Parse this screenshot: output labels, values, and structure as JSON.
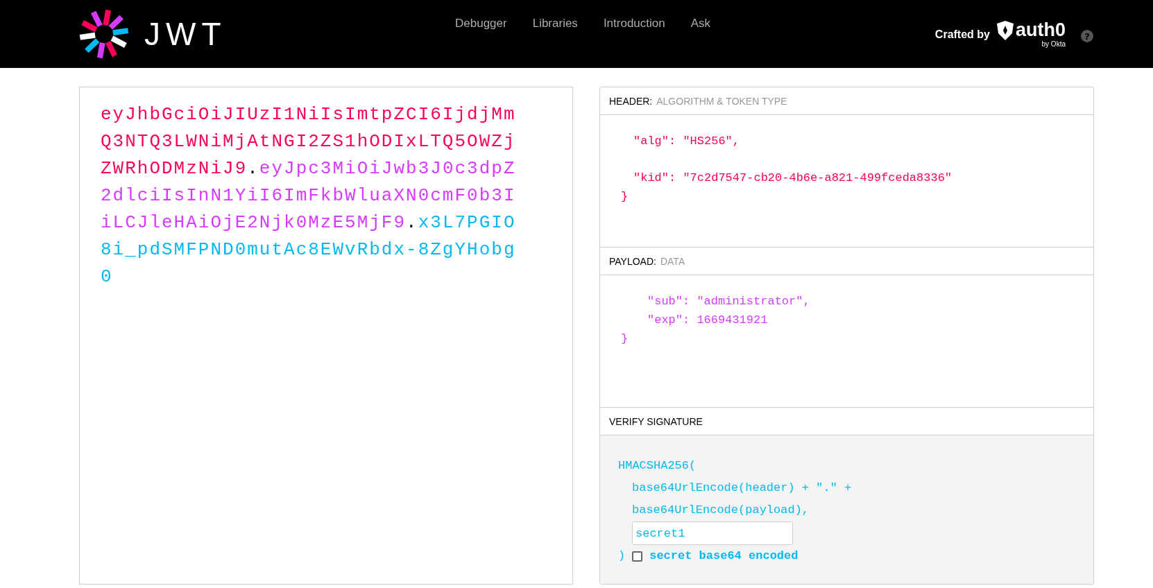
{
  "nav": {
    "logo_text": "JWT",
    "links": [
      "Debugger",
      "Libraries",
      "Introduction",
      "Ask"
    ],
    "crafted_by": "Crafted by",
    "brand": "auth0",
    "brand_sub": "by Okta",
    "help": "?"
  },
  "encoded": {
    "parts": [
      {
        "text": "eyJhbGciOiJIUzI1NiIsImtpZCI6IjdjMmQ3NTQ3LWNiMjAtNGI2ZS1hODIxLTQ5OWZjZWRhODMzNiJ9",
        "color": "#fb015b"
      },
      {
        "text": "eyJpc3MiOiJwb3J0c3dpZ2dlciIsInN1YiI6ImFkbWluaXN0cmF0b3IiLCJleHAiOjE2Njk0MzE5MjF9",
        "color": "#d63aff"
      },
      {
        "text": "x3L7PGIO8i_pdSMFPND0mutAc8EWvRbdx-8ZgYHobg0",
        "color": "#00b9f1"
      }
    ],
    "separator": "."
  },
  "sections": [
    {
      "title": "HEADER:",
      "subtitle": "ALGORITHM & TOKEN TYPE",
      "color": "#fb015b",
      "lines": [
        {
          "kind": "property",
          "text": "\"alg\": \"HS256\","
        },
        {
          "kind": "spaced",
          "text": "\"kid\": \"7c2d7547-cb20-4b6e-a821-499fceda8336\""
        },
        {
          "kind": "brace",
          "text": "}"
        }
      ]
    },
    {
      "title": "PAYLOAD:",
      "subtitle": "DATA",
      "color": "#d63aff",
      "lines": [
        {
          "kind": "nested",
          "text": "\"sub\": \"administrator\","
        },
        {
          "kind": "nested",
          "text": "\"exp\": 1669431921"
        },
        {
          "kind": "brace",
          "text": "}"
        }
      ]
    }
  ],
  "verify": {
    "title": "VERIFY SIGNATURE",
    "func": "HMACSHA256(",
    "args": [
      "base64UrlEncode(header) + \".\" +",
      "base64UrlEncode(payload),"
    ],
    "secret": "secret1",
    "close": ")",
    "base64_label": "secret base64 encoded",
    "base64_checked": false
  }
}
